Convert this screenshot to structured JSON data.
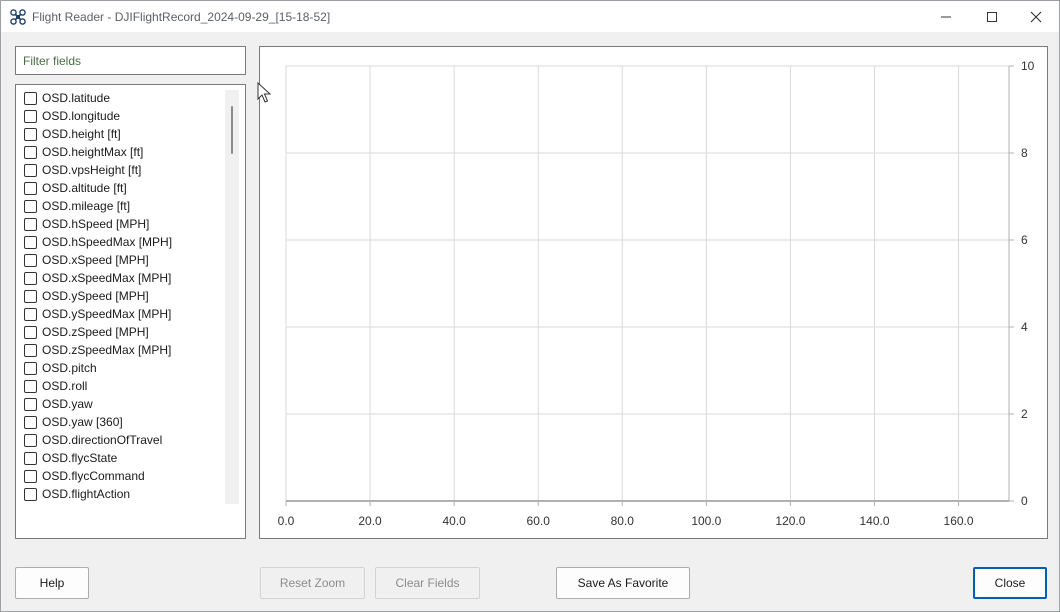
{
  "window": {
    "title": "Flight Reader - DJIFlightRecord_2024-09-29_[15-18-52]",
    "app_icon": "drone-icon",
    "controls": {
      "minimize_icon": "minimize-icon",
      "maximize_icon": "maximize-icon",
      "close_icon": "close-icon"
    }
  },
  "filter": {
    "placeholder": "Filter fields",
    "value": ""
  },
  "fields": [
    {
      "label": "OSD.latitude",
      "checked": false
    },
    {
      "label": "OSD.longitude",
      "checked": false
    },
    {
      "label": "OSD.height [ft]",
      "checked": false
    },
    {
      "label": "OSD.heightMax [ft]",
      "checked": false
    },
    {
      "label": "OSD.vpsHeight [ft]",
      "checked": false
    },
    {
      "label": "OSD.altitude [ft]",
      "checked": false
    },
    {
      "label": "OSD.mileage [ft]",
      "checked": false
    },
    {
      "label": "OSD.hSpeed [MPH]",
      "checked": false
    },
    {
      "label": "OSD.hSpeedMax [MPH]",
      "checked": false
    },
    {
      "label": "OSD.xSpeed [MPH]",
      "checked": false
    },
    {
      "label": "OSD.xSpeedMax [MPH]",
      "checked": false
    },
    {
      "label": "OSD.ySpeed [MPH]",
      "checked": false
    },
    {
      "label": "OSD.ySpeedMax [MPH]",
      "checked": false
    },
    {
      "label": "OSD.zSpeed [MPH]",
      "checked": false
    },
    {
      "label": "OSD.zSpeedMax [MPH]",
      "checked": false
    },
    {
      "label": "OSD.pitch",
      "checked": false
    },
    {
      "label": "OSD.roll",
      "checked": false
    },
    {
      "label": "OSD.yaw",
      "checked": false
    },
    {
      "label": "OSD.yaw [360]",
      "checked": false
    },
    {
      "label": "OSD.directionOfTravel",
      "checked": false
    },
    {
      "label": "OSD.flycState",
      "checked": false
    },
    {
      "label": "OSD.flycCommand",
      "checked": false
    },
    {
      "label": "OSD.flightAction",
      "checked": false
    }
  ],
  "chart": {
    "x_ticks": [
      "0.0",
      "20.0",
      "40.0",
      "60.0",
      "80.0",
      "100.0",
      "120.0",
      "140.0",
      "160.0"
    ],
    "y_ticks": [
      "0",
      "2",
      "4",
      "6",
      "8",
      "10"
    ],
    "grid_color": "#d9d9d9",
    "axis_color": "#b0b0b0"
  },
  "chart_data": {
    "type": "line",
    "title": "",
    "xlabel": "",
    "ylabel": "",
    "xlim": [
      0,
      172
    ],
    "ylim": [
      0,
      10
    ],
    "x_ticks": [
      0,
      20,
      40,
      60,
      80,
      100,
      120,
      140,
      160
    ],
    "y_ticks": [
      0,
      2,
      4,
      6,
      8,
      10
    ],
    "y_axis_side": "right",
    "grid": true,
    "series": []
  },
  "buttons": {
    "help": "Help",
    "reset_zoom": "Reset Zoom",
    "clear_fields": "Clear Fields",
    "save_favorite": "Save As Favorite",
    "close": "Close"
  },
  "colors": {
    "accent": "#005fb8",
    "placeholder": "#4a6e4a"
  }
}
